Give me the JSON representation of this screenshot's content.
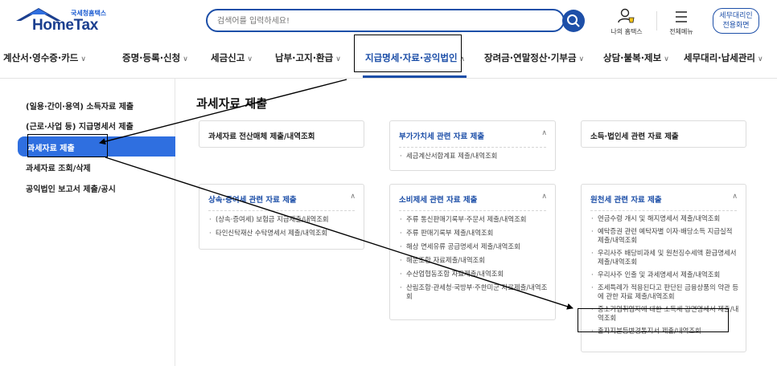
{
  "header": {
    "logo_small": "국세청홈택스",
    "logo_main": "HomeTax",
    "search_placeholder": "검색어를 입력하세요!",
    "my_hometax": "나의 홈택스",
    "all_menu": "전체메뉴",
    "tax_agent_btn_line1": "세무대리인",
    "tax_agent_btn_line2": "전용화면"
  },
  "nav": {
    "items": [
      "계산서·영수증·카드",
      "증명·등록·신청",
      "세금신고",
      "납부·고지·환급",
      "지급명세·자료·공익법인",
      "장려금·연말정산·기부금",
      "상담·불복·제보",
      "세무대리·납세관리"
    ]
  },
  "sidebar": {
    "items": [
      "(일용·간이·용역) 소득자료 제출",
      "(근로·사업 등) 지급명세서 제출",
      "과세자료 제출",
      "과세자료 조회/삭제",
      "공익법인 보고서 제출/공시"
    ]
  },
  "main": {
    "title": "과세자료 제출",
    "cards": [
      {
        "title": "과세자료 전산매체 제출/내역조회",
        "items": []
      },
      {
        "title": "부가가치세 관련 자료 제출",
        "items": [
          "세금계산서합계표 제출/내역조회"
        ]
      },
      {
        "title": "소득·법인세 관련 자료 제출",
        "items": []
      },
      {
        "title": "상속·증여세 관련 자료 제출",
        "items": [
          "(상속·증여세) 보험금 지급제출/내역조회",
          "타인신탁재산 수탁명세서 제출/내역조회"
        ]
      },
      {
        "title": "소비제세 관련 자료 제출",
        "items": [
          "주류 통신판매기록부·주문서 제출/내역조회",
          "주류 판매기록부 제출/내역조회",
          "해상 면세유류 공급명세서 제출/내역조회",
          "해운조합 자료제출/내역조회",
          "수산업협동조합 자료제출/내역조회",
          "산림조합·관세청·국방부·주한미군 자료제출/내역조회"
        ]
      },
      {
        "title": "원천세 관련 자료 제출",
        "items": [
          "연금수령 개시 및 해지명세서 제출/내역조회",
          "예탁증권 관련 예탁자별 이자·배당소득 지급실적 제출/내역조회",
          "우리사주 배당비과세 및 원천징수세액 환급명세서 제출/내역조회",
          "우리사주 인출 및 과세명세서 제출/내역조회",
          "조세특례가 적용된다고 판단된 금융상품의 약관 등에 관한 자료 제출/내역조회",
          "중소기업취업자에 대한 소득세 감면명세서 제출/내역조회",
          "출자지분등변경통지서 제출/내역조회"
        ]
      }
    ]
  },
  "colors": {
    "brand_blue": "#1d4fa8",
    "active_blue": "#2f6fe0",
    "annotation": "#000000"
  }
}
